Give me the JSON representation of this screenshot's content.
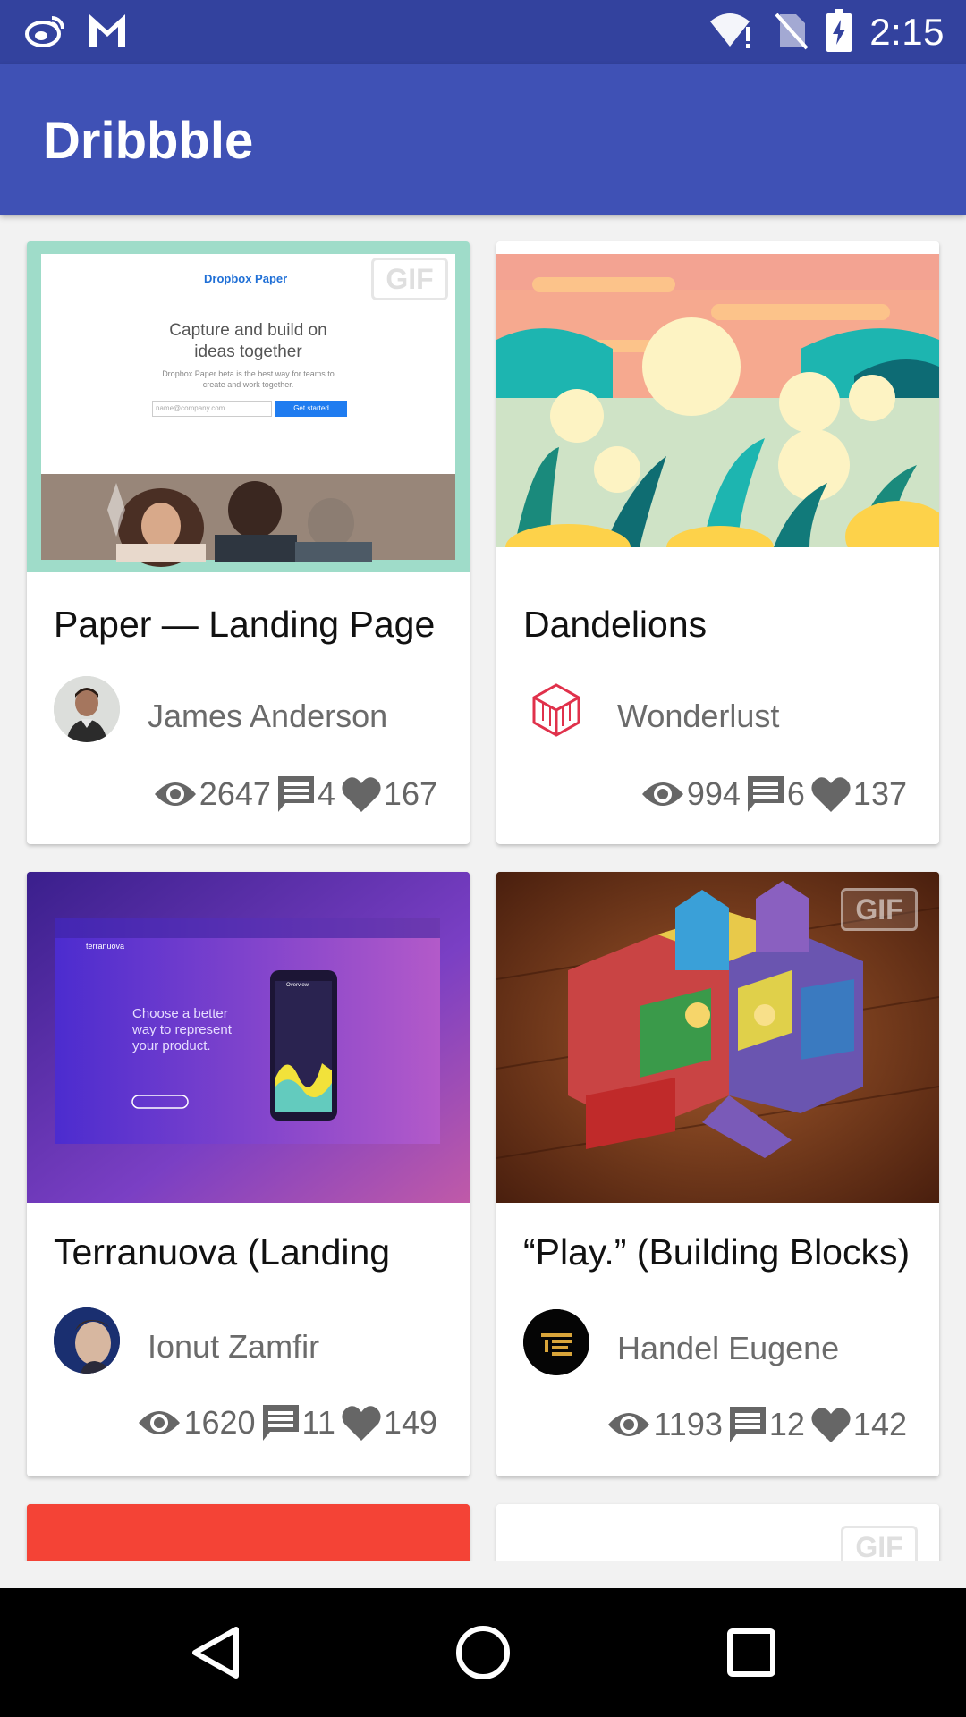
{
  "status_bar": {
    "time": "2:15",
    "left_icons": [
      "weibo-icon",
      "gmail-icon"
    ],
    "right_icons": [
      "wifi-alert-icon",
      "no-sim-icon",
      "battery-charging-icon"
    ]
  },
  "app_bar": {
    "title": "Dribbble"
  },
  "colors": {
    "primary": "#3f51b5",
    "primary_dark": "#33429e",
    "accent_red": "#f44336"
  },
  "preview_texts": {
    "paper_brand": "Dropbox Paper",
    "paper_headline_1": "Capture and build on",
    "paper_headline_2": "ideas together",
    "paper_sub_1": "Dropbox Paper beta is the best way for teams to",
    "paper_sub_2": "create and work together.",
    "paper_input": "name@company.com",
    "paper_button": "Get started",
    "terra_brand": "terranuova",
    "terra_line_1": "Choose a better",
    "terra_line_2": "way to represent",
    "terra_line_3": "your product.",
    "terra_phone_title": "Overview"
  },
  "shots": [
    {
      "title": "Paper — Landing Page",
      "author": "James Anderson",
      "views": "2647",
      "comments": "4",
      "likes": "167",
      "gif": "GIF"
    },
    {
      "title": "Dandelions",
      "author": "Wonderlust",
      "views": "994",
      "comments": "6",
      "likes": "137"
    },
    {
      "title": "Terranuova (Landing",
      "author": "Ionut Zamfir",
      "views": "1620",
      "comments": "11",
      "likes": "149"
    },
    {
      "title": "“Play.” (Building Blocks)",
      "author": "Handel Eugene",
      "views": "1193",
      "comments": "12",
      "likes": "142",
      "gif": "GIF"
    },
    {
      "gif": "GIF"
    }
  ],
  "nav_bar": {
    "buttons": [
      "back-icon",
      "home-icon",
      "recents-icon"
    ]
  }
}
